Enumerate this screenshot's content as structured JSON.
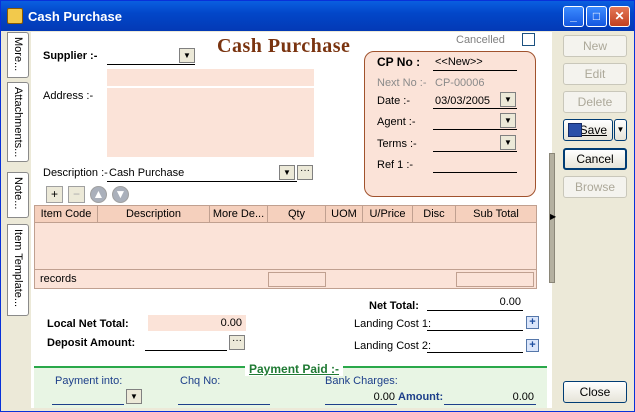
{
  "window": {
    "title": "Cash Purchase"
  },
  "side_tabs": [
    "More...",
    "Attachments...",
    "Note...",
    "Item Template..."
  ],
  "heading": "Cash Purchase",
  "cancelled_label": "Cancelled",
  "supplier": {
    "label": "Supplier :-",
    "value": ""
  },
  "address": {
    "label": "Address :-"
  },
  "description": {
    "label": "Description :-",
    "value": "Cash Purchase"
  },
  "cp_panel": {
    "cp_no_label": "CP No :",
    "cp_no_value": "<<New>>",
    "next_no_label": "Next No :-",
    "next_no_value": "CP-00006",
    "date_label": "Date :-",
    "date_value": "03/03/2005",
    "agent_label": "Agent :-",
    "terms_label": "Terms :-",
    "ref_label": "Ref 1 :-"
  },
  "grid": {
    "columns": [
      "Item Code",
      "Description",
      "More De...",
      "Qty",
      "UOM",
      "U/Price",
      "Disc",
      "Sub Total"
    ],
    "footer_label": "records"
  },
  "totals": {
    "net_total_label": "Net Total:",
    "net_total_value": "0.00",
    "local_net_total_label": "Local Net Total:",
    "local_net_total_value": "0.00",
    "deposit_amount_label": "Deposit Amount:",
    "landing_cost1_label": "Landing Cost 1:",
    "landing_cost2_label": "Landing Cost 2:"
  },
  "payment": {
    "section_title": "Payment Paid :-",
    "payment_into_label": "Payment into:",
    "chq_no_label": "Chq No:",
    "bank_charges_label": "Bank Charges:",
    "bank_charges_value": "0.00",
    "amount_label": "Amount:",
    "amount_value": "0.00"
  },
  "buttons": {
    "new": "New",
    "edit": "Edit",
    "delete": "Delete",
    "save": "Save",
    "cancel": "Cancel",
    "browse": "Browse",
    "close": "Close"
  }
}
